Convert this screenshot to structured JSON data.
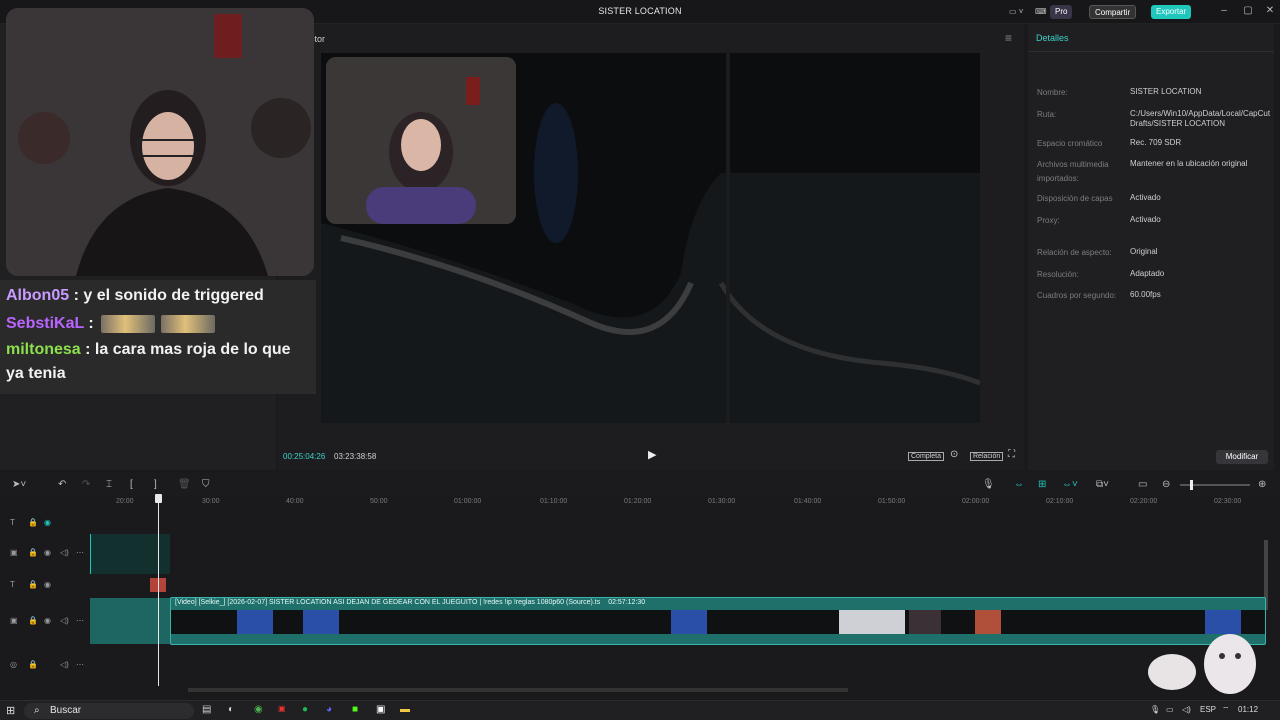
{
  "window": {
    "title": "SISTER LOCATION",
    "pro_label": "Pro",
    "share_label": "Compartir",
    "export_label": "Exportar",
    "accent": "#1fc7bd"
  },
  "player": {
    "tab_label": "ctor",
    "current_time": "00:25:04:26",
    "total_time": "03:23:38:58",
    "complete_label": "Completa",
    "ratio_label": "Relación"
  },
  "chat": [
    {
      "user": "Albon05",
      "color": "#c79bff",
      "text": ": y el sonido de triggered"
    },
    {
      "user": "SebstiKaL",
      "color": "#b864ff",
      "text": ":"
    },
    {
      "user": "miltonesa",
      "color": "#8ce04d",
      "text": ": la cara mas roja de lo que ya tenia"
    }
  ],
  "details": {
    "header": "Detalles",
    "rows": [
      {
        "label": "Nombre:",
        "value": "SISTER LOCATION"
      },
      {
        "label": "Ruta:",
        "value": "C:/Users/Win10/AppData/Local/CapCut Drafts/SISTER LOCATION"
      },
      {
        "label": "Espacio cromático",
        "value": "Rec. 709 SDR"
      },
      {
        "label": "Archivos multimedia importados:",
        "value": "Mantener en la ubicación original"
      },
      {
        "label": "Disposición de capas",
        "value": "Activado"
      },
      {
        "label": "Proxy:",
        "value": "Activado"
      },
      {
        "label": "Relación de aspecto:",
        "value": "Original"
      },
      {
        "label": "Resolución:",
        "value": "Adaptado"
      },
      {
        "label": "Cuadros por segundo:",
        "value": "60.00fps"
      }
    ],
    "modify_label": "Modificar"
  },
  "timeline": {
    "ruler_ticks": [
      "20:00",
      "30:00",
      "40:00",
      "50:00",
      "01:00:00",
      "01:10:00",
      "01:20:00",
      "01:30:00",
      "01:40:00",
      "01:50:00",
      "02:00:00",
      "02:10:00",
      "02:20:00",
      "02:30:00"
    ],
    "clip_label": "[Video] [Selkie_] [2026-02-07] SISTER LOCATION ASI DEJAN DE GEDEAR CON EL JUEGUITO  |  !redes !ip !reglas 1080p60 (Source).ts",
    "clip_duration": "02:57:12:30"
  },
  "taskbar": {
    "search_placeholder": "Buscar",
    "lang": "ESP",
    "time": "01:12"
  }
}
